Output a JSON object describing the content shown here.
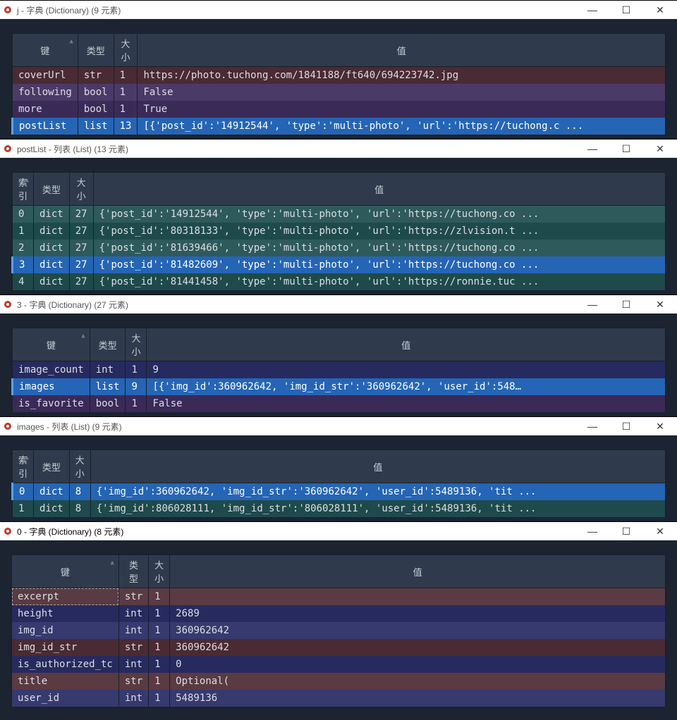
{
  "windows": [
    {
      "title": "j - 字典 (Dictionary) (9 元素)",
      "headers": {
        "key": "键",
        "type": "类型",
        "size": "大小",
        "value": "值"
      },
      "rows": [
        {
          "key": "coverUrl",
          "type": "str",
          "size": "1",
          "value": "https://photo.tuchong.com/1841188/ft640/694223742.jpg",
          "cls": "row-maroon-dark"
        },
        {
          "key": "following",
          "type": "bool",
          "size": "1",
          "value": "False",
          "cls": "row-purple-light"
        },
        {
          "key": "more",
          "type": "bool",
          "size": "1",
          "value": "True",
          "cls": "row-purple-dark"
        },
        {
          "key": "postList",
          "type": "list",
          "size": "13",
          "value": "[{'post_id':'14912544', 'type':'multi-photo', 'url':'https://tuchong.c ...",
          "cls": "row-blue-sel sel-marker"
        }
      ]
    },
    {
      "title": "postList - 列表 (List) (13 元素)",
      "headers": {
        "key": "索引",
        "type": "类型",
        "size": "大小",
        "value": "值"
      },
      "rows": [
        {
          "key": "0",
          "type": "dict",
          "size": "27",
          "value": "{'post_id':'14912544', 'type':'multi-photo', 'url':'https://tuchong.co ...",
          "cls": "row-teal-a"
        },
        {
          "key": "1",
          "type": "dict",
          "size": "27",
          "value": "{'post_id':'80318133', 'type':'multi-photo', 'url':'https://zlvision.t ...",
          "cls": "row-teal-b"
        },
        {
          "key": "2",
          "type": "dict",
          "size": "27",
          "value": "{'post_id':'81639466', 'type':'multi-photo', 'url':'https://tuchong.co ...",
          "cls": "row-teal-a"
        },
        {
          "key": "3",
          "type": "dict",
          "size": "27",
          "value": "{'post_id':'81482609', 'type':'multi-photo', 'url':'https://tuchong.co ...",
          "cls": "row-blue-sel sel-marker"
        },
        {
          "key": "4",
          "type": "dict",
          "size": "27",
          "value": "{'post_id':'81441458', 'type':'multi-photo', 'url':'https://ronnie.tuc ...",
          "cls": "row-teal-b"
        }
      ]
    },
    {
      "title": "3 - 字典 (Dictionary) (27 元素)",
      "headers": {
        "key": "键",
        "type": "类型",
        "size": "大小",
        "value": "值"
      },
      "rows": [
        {
          "key": "image_count",
          "type": "int",
          "size": "1",
          "value": "9",
          "cls": "row-navy-a"
        },
        {
          "key": "images",
          "type": "list",
          "size": "9",
          "value": "[{'img_id':360962642, 'img_id_str':'360962642', 'user_id':548…",
          "cls": "row-blue-sel sel-marker"
        },
        {
          "key": "is_favorite",
          "type": "bool",
          "size": "1",
          "value": "False",
          "cls": "row-purple-dark"
        }
      ]
    },
    {
      "title": "images - 列表 (List) (9 元素)",
      "headers": {
        "key": "索引",
        "type": "类型",
        "size": "大小",
        "value": "值"
      },
      "rows": [
        {
          "key": "0",
          "type": "dict",
          "size": "8",
          "value": "{'img_id':360962642, 'img_id_str':'360962642', 'user_id':5489136, 'tit ...",
          "cls": "row-blue-sel sel-marker"
        },
        {
          "key": "1",
          "type": "dict",
          "size": "8",
          "value": "{'img_id':806028111, 'img_id_str':'806028111', 'user_id':5489136, 'tit ...",
          "cls": "row-teal-b"
        }
      ]
    },
    {
      "title": "0 - 字典 (Dictionary) (8 元素)",
      "active": true,
      "headers": {
        "key": "键",
        "type": "类型",
        "size": "大小",
        "value": "值"
      },
      "rows": [
        {
          "key": "excerpt",
          "type": "str",
          "size": "1",
          "value": "",
          "cls": "row-maroon-light row-focus"
        },
        {
          "key": "height",
          "type": "int",
          "size": "1",
          "value": "2689",
          "cls": "row-navy-a"
        },
        {
          "key": "img_id",
          "type": "int",
          "size": "1",
          "value": "360962642",
          "cls": "row-navy-b"
        },
        {
          "key": "img_id_str",
          "type": "str",
          "size": "1",
          "value": "360962642",
          "cls": "row-maroon-dark"
        },
        {
          "key": "is_authorized_tc",
          "type": "int",
          "size": "1",
          "value": "0",
          "cls": "row-navy-a"
        },
        {
          "key": "title",
          "type": "str",
          "size": "1",
          "value": "Optional(",
          "cls": "row-maroon-light"
        },
        {
          "key": "user_id",
          "type": "int",
          "size": "1",
          "value": "5489136",
          "cls": "row-navy-b"
        }
      ]
    }
  ]
}
